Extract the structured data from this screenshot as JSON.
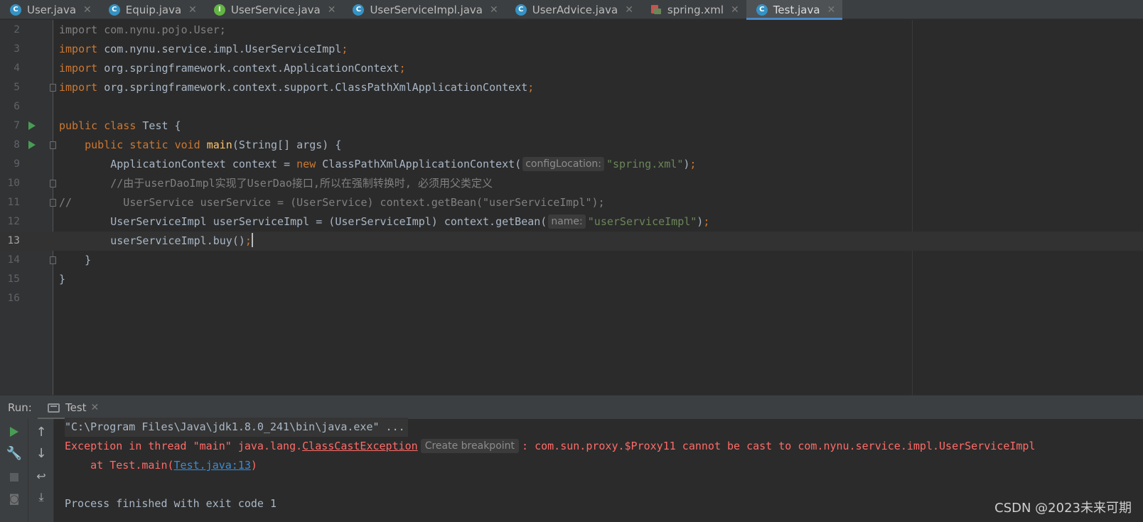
{
  "tabs": [
    {
      "label": "User.java",
      "icon": "class-icon",
      "icon_letter": "C"
    },
    {
      "label": "Equip.java",
      "icon": "class-icon",
      "icon_letter": "C"
    },
    {
      "label": "UserService.java",
      "icon": "interface-icon",
      "icon_letter": "I"
    },
    {
      "label": "UserServiceImpl.java",
      "icon": "class-icon",
      "icon_letter": "C"
    },
    {
      "label": "UserAdvice.java",
      "icon": "class-icon",
      "icon_letter": "C"
    },
    {
      "label": "spring.xml",
      "icon": "xml-file-icon",
      "icon_letter": ""
    },
    {
      "label": "Test.java",
      "icon": "runnable-class-icon",
      "icon_letter": "C",
      "active": true
    }
  ],
  "editor": {
    "current_line": 13,
    "lines": [
      {
        "n": "2",
        "code": {
          "kw1": "import",
          "rest": " com.nynu.pojo.User;"
        }
      },
      {
        "n": "3",
        "code": {
          "kw1": "import",
          "rest": " com.nynu.service.impl.UserServiceImpl",
          "semi": ";"
        }
      },
      {
        "n": "4",
        "code": {
          "kw1": "import",
          "rest": " org.springframework.context.ApplicationContext",
          "semi": ";"
        }
      },
      {
        "n": "5",
        "code": {
          "kw1": "import",
          "rest": " org.springframework.context.support.ClassPathXmlApplicationContext",
          "semi": ";"
        }
      },
      {
        "n": "6"
      },
      {
        "n": "7",
        "code": {
          "kw1": "public",
          "kw2": "class",
          "rest": " Test {"
        }
      },
      {
        "n": "8",
        "code": {
          "indent": "    ",
          "kw1": "public",
          "kw2": "static",
          "kw3": "void",
          "fn": "main",
          "rest": "(String[] args) {"
        }
      },
      {
        "n": "9",
        "code": {
          "a": "        ApplicationContext context = ",
          "kw": "new",
          "b": " ClassPathXmlApplicationContext(",
          "hint": "configLocation:",
          "str": "\"spring.xml\"",
          "c": ")",
          "semi": ";"
        }
      },
      {
        "n": "10",
        "code": {
          "comment": "        //由于userDaoImpl实现了UserDao接口,所以在强制转换时, 必须用父类定义"
        }
      },
      {
        "n": "11",
        "code": {
          "comment": "//        UserService userService = (UserService) context.getBean(\"userServiceImpl\");"
        }
      },
      {
        "n": "12",
        "code": {
          "a": "        UserServiceImpl userServiceImpl = (UserServiceImpl) context.getBean(",
          "hint": "name:",
          "str": "\"userServiceImpl\"",
          "c": ")",
          "semi": ";"
        }
      },
      {
        "n": "13",
        "code": {
          "a": "        userServiceImpl.buy()",
          "semi": ";"
        }
      },
      {
        "n": "14",
        "code": {
          "a": "    }"
        }
      },
      {
        "n": "15",
        "code": {
          "a": "}"
        }
      },
      {
        "n": "16"
      }
    ]
  },
  "run_panel": {
    "label": "Run:",
    "tab_label": "Test",
    "console": {
      "cmd": "\"C:\\Program Files\\Java\\jdk1.8.0_241\\bin\\java.exe\" ...",
      "exc_prefix": "Exception in thread \"main\" java.lang.",
      "exc_class": "ClassCastException",
      "breakpoint_hint": "Create breakpoint",
      "exc_msg": ": com.sun.proxy.$Proxy11 cannot be cast to com.nynu.service.impl.UserServiceImpl",
      "at_prefix": "    at Test.main(",
      "at_link": "Test.java:13",
      "at_suffix": ")",
      "finished": "Process finished with exit code 1"
    }
  },
  "watermark": "CSDN @2023未来可期"
}
